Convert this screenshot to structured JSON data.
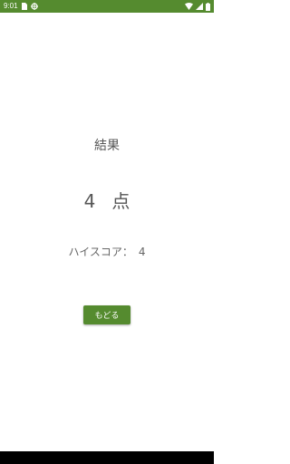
{
  "status_bar": {
    "time": "9:01",
    "background_color": "#558b2f",
    "left_icons": [
      "sim-card-icon",
      "crosshair-icon"
    ],
    "right_icons": [
      "wifi-icon",
      "signal-icon",
      "battery-icon"
    ]
  },
  "result": {
    "title": "結果",
    "score": "4",
    "score_unit": "点",
    "highscore_label": "ハイスコア：",
    "highscore_value": "4"
  },
  "actions": {
    "back_label": "もどる",
    "button_color": "#558b2f"
  }
}
